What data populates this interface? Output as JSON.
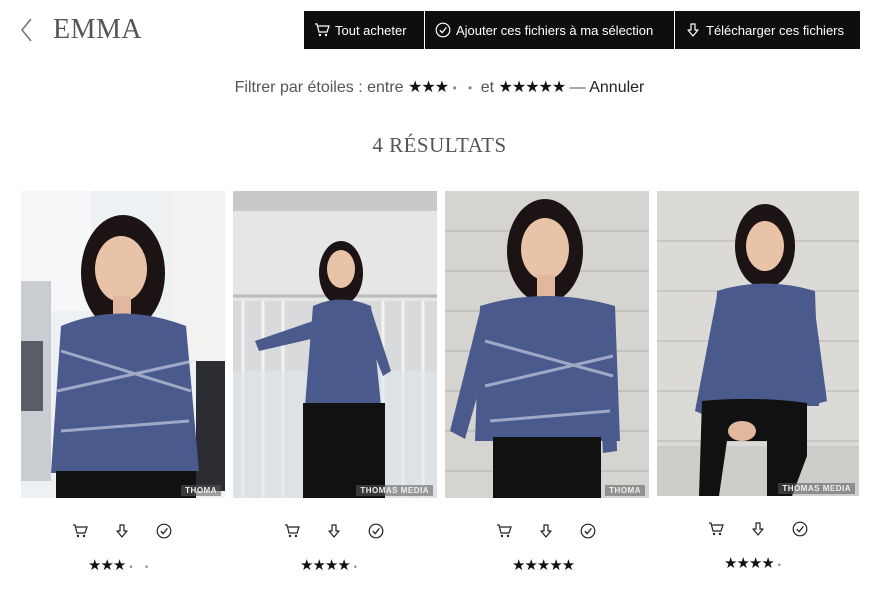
{
  "header": {
    "title": "EMMA",
    "buttons": {
      "buy_all": "Tout acheter",
      "add_selection": "Ajouter ces fichiers à ma sélection",
      "download": "Télécharger ces fichiers"
    }
  },
  "filter": {
    "prefix": "Filtrer par étoiles : entre",
    "min_stars": "★★★",
    "min_dots": "• •",
    "between": "et",
    "max_stars": "★★★★★",
    "dash": "—",
    "cancel": "Annuler"
  },
  "results": {
    "label": "4 RÉSULTATS"
  },
  "photos": [
    {
      "watermark": "THOMA",
      "stars": "★★★",
      "dots": "• •",
      "rating": 3
    },
    {
      "watermark": "THOMAS MEDIA",
      "stars": "★★★★",
      "dots": "•",
      "rating": 4
    },
    {
      "watermark": "THOMA",
      "stars": "★★★★★",
      "dots": "",
      "rating": 5
    },
    {
      "watermark": "THOMAS MEDIA",
      "stars": "★★★★",
      "dots": "•",
      "rating": 4
    }
  ],
  "colors": {
    "button_bg": "#0e0e0e",
    "button_text": "#ffffff",
    "blouse": "#4a5a8c",
    "hair": "#1c1414"
  }
}
